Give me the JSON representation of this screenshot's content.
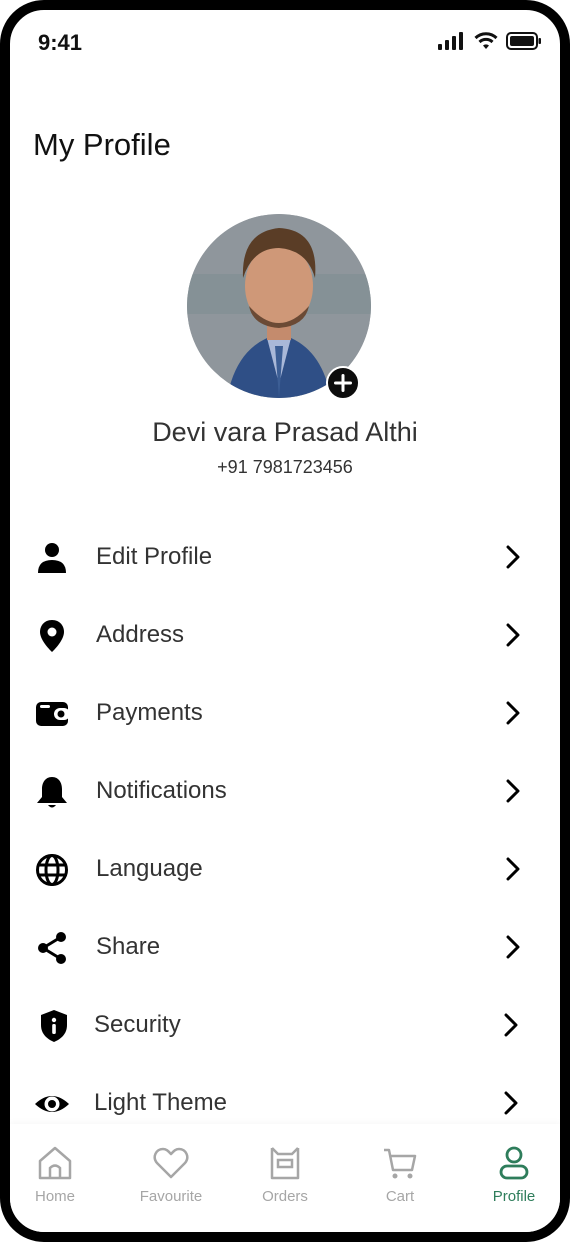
{
  "status_bar": {
    "time": "9:41"
  },
  "header": {
    "title": "My Profile"
  },
  "profile": {
    "name": "Devi vara Prasad Althi",
    "phone": "+91 7981723456"
  },
  "menu": {
    "items": [
      {
        "label": "Edit Profile",
        "icon": "person-icon"
      },
      {
        "label": "Address",
        "icon": "location-pin-icon"
      },
      {
        "label": "Payments",
        "icon": "wallet-icon"
      },
      {
        "label": "Notifications",
        "icon": "bell-icon"
      },
      {
        "label": "Language",
        "icon": "globe-icon"
      },
      {
        "label": "Share",
        "icon": "share-icon"
      },
      {
        "label": "Security",
        "icon": "shield-icon"
      },
      {
        "label": "Light Theme",
        "icon": "eye-icon"
      }
    ]
  },
  "tabbar": {
    "tabs": [
      {
        "label": "Home",
        "icon": "home-icon"
      },
      {
        "label": "Favourite",
        "icon": "heart-icon"
      },
      {
        "label": "Orders",
        "icon": "box-icon"
      },
      {
        "label": "Cart",
        "icon": "cart-icon"
      },
      {
        "label": "Profile",
        "icon": "profile-icon",
        "active": true
      }
    ]
  },
  "colors": {
    "accent": "#2e7d5b",
    "inactive": "#a6a6a6",
    "text": "#333333"
  }
}
